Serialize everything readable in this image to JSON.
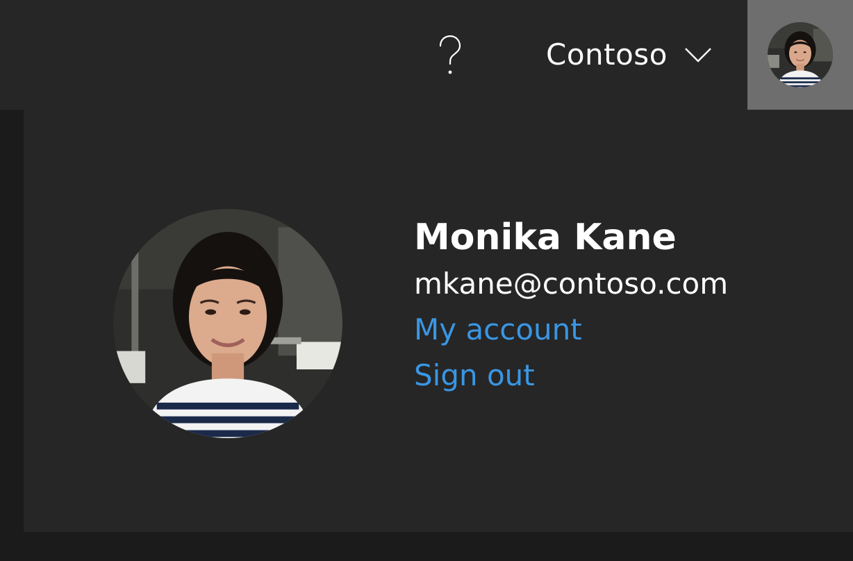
{
  "header": {
    "help_icon": "question-mark-icon",
    "tenant": {
      "label": "Contoso",
      "icon": "chevron-down-icon"
    },
    "avatar": {
      "icon": "user-avatar"
    }
  },
  "account_panel": {
    "name": "Monika Kane",
    "email": "mkane@contoso.com",
    "links": {
      "my_account": "My account",
      "sign_out": "Sign out"
    }
  },
  "colors": {
    "header_bg": "#262626",
    "avatar_button_bg": "#6e6e6e",
    "panel_bg": "#262626",
    "page_bg": "#1b1b1b",
    "link": "#3a96e3",
    "text": "#ffffff"
  }
}
